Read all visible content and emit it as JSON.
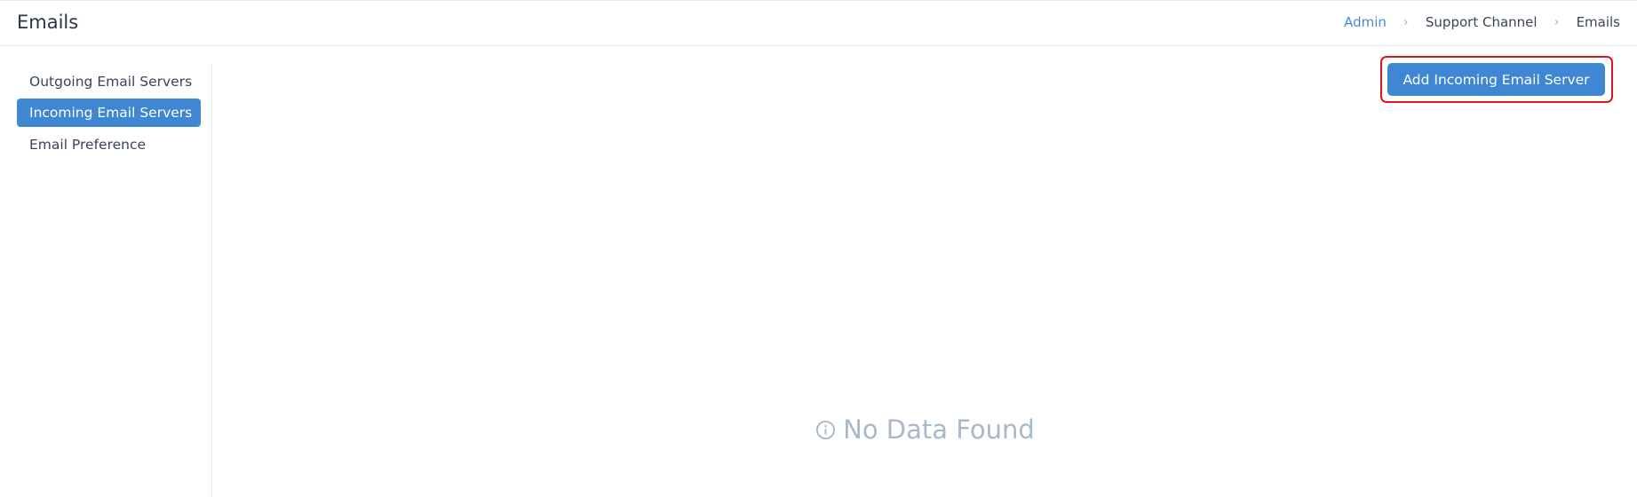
{
  "header": {
    "title": "Emails",
    "breadcrumb": [
      {
        "label": "Admin",
        "link": true
      },
      {
        "label": "Support Channel",
        "link": false
      },
      {
        "label": "Emails",
        "link": false
      }
    ],
    "separator": "›"
  },
  "sidebar": {
    "items": [
      {
        "label": "Outgoing Email Servers",
        "active": false
      },
      {
        "label": "Incoming Email Servers",
        "active": true
      },
      {
        "label": "Email Preference",
        "active": false
      }
    ]
  },
  "main": {
    "add_button_label": "Add Incoming Email Server",
    "empty_message": "No Data Found",
    "empty_icon": "info-circle-icon"
  },
  "colors": {
    "accent": "#3f87d2",
    "link": "#4a8ad4",
    "highlight_border": "#e0141a",
    "empty_text": "#a8b9cc"
  }
}
